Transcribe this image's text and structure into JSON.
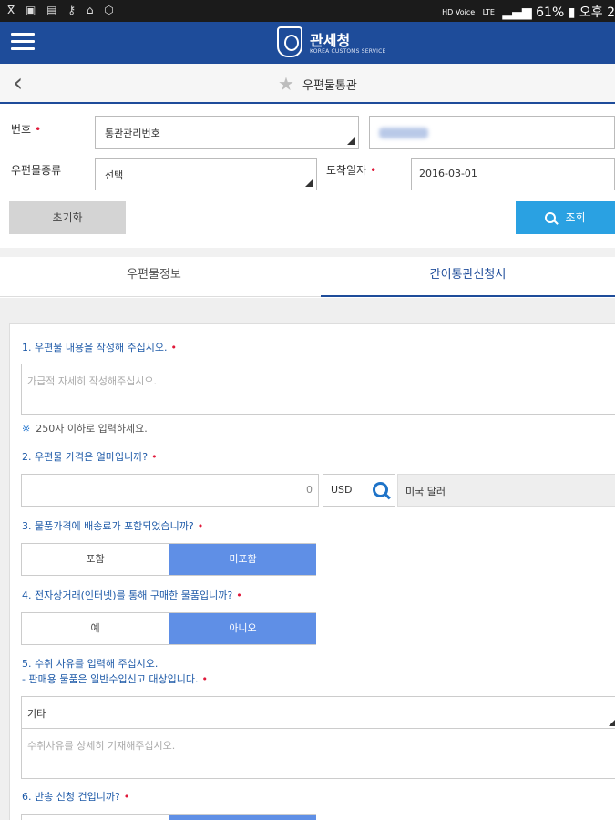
{
  "status_bar": {
    "left_icons": "ⴳ ▣ ▤ ⚷ ⌂ ⬡",
    "hd_voice": "HD Voice",
    "network": "LTE",
    "battery_pct": "61%",
    "time": "오후 2"
  },
  "app_header": {
    "title": "관세청",
    "subtitle": "KOREA CUSTOMS SERVICE"
  },
  "sub_header": {
    "page_title": "우편물통관"
  },
  "search_form": {
    "number_label": "번호",
    "number_type_value": "통관관리번호",
    "mail_type_label": "우편물종류",
    "mail_type_value": "선택",
    "arrival_date_label": "도착일자",
    "arrival_date_value": "2016-03-01",
    "required_mark": "•",
    "reset_button": "초기화",
    "search_button": "조회"
  },
  "tabs": [
    {
      "label": "우편물정보",
      "active": false
    },
    {
      "label": "간이통관신청서",
      "active": true
    }
  ],
  "declaration": {
    "q1": "1. 우편물 내용을 작성해 주십시오.",
    "q1_placeholder": "가급적 자세히 작성해주십시오.",
    "q1_hint_mark": "※",
    "q1_hint": "250자 이하로 입력하세요.",
    "q2": "2. 우편물 가격은 얼마입니까?",
    "price_value": "0",
    "currency_code": "USD",
    "currency_name": "미국 달러",
    "q3": "3. 물품가격에 배송료가 포함되었습니까?",
    "q3_options": [
      "포함",
      "미포함"
    ],
    "q3_selected": "미포함",
    "q4": "4. 전자상거래(인터넷)를 통해 구매한 물품입니까?",
    "q4_options": [
      "예",
      "아니오"
    ],
    "q4_selected": "아니오",
    "q5_line1": "5. 수취 사유를 입력해 주십시오.",
    "q5_line2": "- 판매용 물품은 일반수입신고 대상입니다.",
    "q5_reason_value": "기타",
    "q5_placeholder": "수취사유를 상세히 기재해주십시오.",
    "q6": "6. 반송 신청 건입니까?"
  },
  "colors": {
    "primary": "#1e4c9a",
    "search_button": "#2aa1e2",
    "toggle_selected": "#5f8fe6",
    "required": "#e0193a",
    "question_text": "#1e5aa8"
  }
}
